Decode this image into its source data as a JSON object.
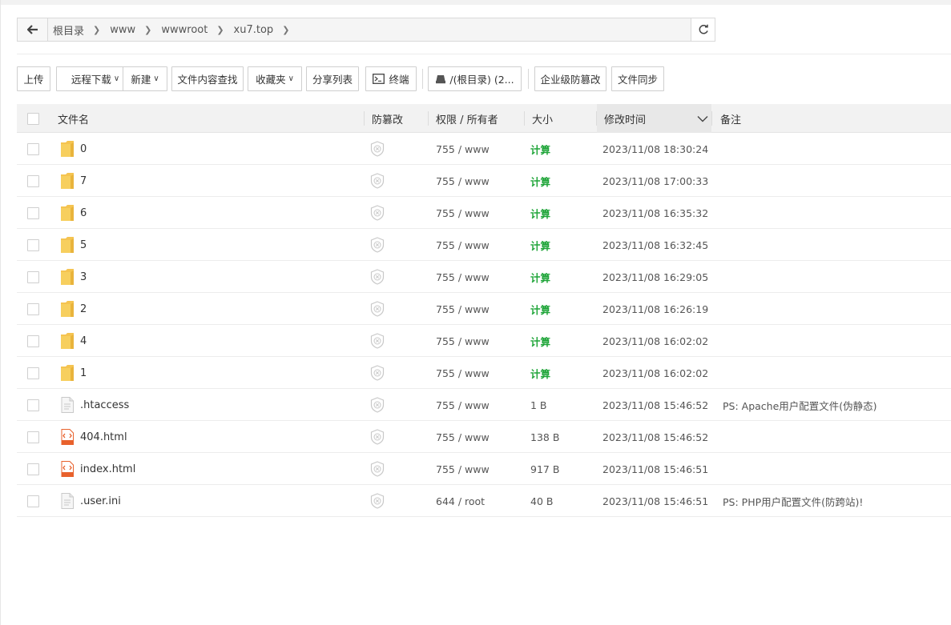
{
  "breadcrumb": {
    "items": [
      "根目录",
      "www",
      "wwwroot",
      "xu7.top"
    ]
  },
  "toolbar": {
    "upload": "上传",
    "remote_download": "远程下载",
    "new": "新建",
    "search_content": "文件内容查找",
    "favorites": "收藏夹",
    "share_list": "分享列表",
    "terminal": "终端",
    "disk": "/(根目录) (2...",
    "enterprise_tamper": "企业级防篡改",
    "file_sync": "文件同步"
  },
  "table": {
    "columns": {
      "name": "文件名",
      "tamper": "防篡改",
      "perm": "权限 / 所有者",
      "size": "大小",
      "mtime": "修改时间",
      "remark": "备注"
    },
    "rows": [
      {
        "name": "0",
        "type": "folder",
        "perm": "755 / www",
        "size": "计算",
        "mtime": "2023/11/08 18:30:24",
        "remark": ""
      },
      {
        "name": "7",
        "type": "folder",
        "perm": "755 / www",
        "size": "计算",
        "mtime": "2023/11/08 17:00:33",
        "remark": ""
      },
      {
        "name": "6",
        "type": "folder",
        "perm": "755 / www",
        "size": "计算",
        "mtime": "2023/11/08 16:35:32",
        "remark": ""
      },
      {
        "name": "5",
        "type": "folder",
        "perm": "755 / www",
        "size": "计算",
        "mtime": "2023/11/08 16:32:45",
        "remark": ""
      },
      {
        "name": "3",
        "type": "folder",
        "perm": "755 / www",
        "size": "计算",
        "mtime": "2023/11/08 16:29:05",
        "remark": ""
      },
      {
        "name": "2",
        "type": "folder",
        "perm": "755 / www",
        "size": "计算",
        "mtime": "2023/11/08 16:26:19",
        "remark": ""
      },
      {
        "name": "4",
        "type": "folder",
        "perm": "755 / www",
        "size": "计算",
        "mtime": "2023/11/08 16:02:02",
        "remark": ""
      },
      {
        "name": "1",
        "type": "folder",
        "perm": "755 / www",
        "size": "计算",
        "mtime": "2023/11/08 16:02:02",
        "remark": ""
      },
      {
        "name": ".htaccess",
        "type": "file",
        "perm": "755 / www",
        "size": "1 B",
        "mtime": "2023/11/08 15:46:52",
        "remark": "PS: Apache用户配置文件(伪静态)"
      },
      {
        "name": "404.html",
        "type": "html",
        "perm": "755 / www",
        "size": "138 B",
        "mtime": "2023/11/08 15:46:52",
        "remark": ""
      },
      {
        "name": "index.html",
        "type": "html",
        "perm": "755 / www",
        "size": "917 B",
        "mtime": "2023/11/08 15:46:51",
        "remark": ""
      },
      {
        "name": ".user.ini",
        "type": "file",
        "perm": "644 / root",
        "size": "40 B",
        "mtime": "2023/11/08 15:46:51",
        "remark": "PS: PHP用户配置文件(防跨站)!"
      }
    ]
  },
  "icons": {
    "folder": "folder-icon",
    "file": "file-icon",
    "html": "html-file-icon",
    "tamper": "shield-x-icon"
  },
  "colors": {
    "calc_green": "#20a53a",
    "folder_yellow": "#f7c948",
    "html_orange": "#e8612c"
  }
}
